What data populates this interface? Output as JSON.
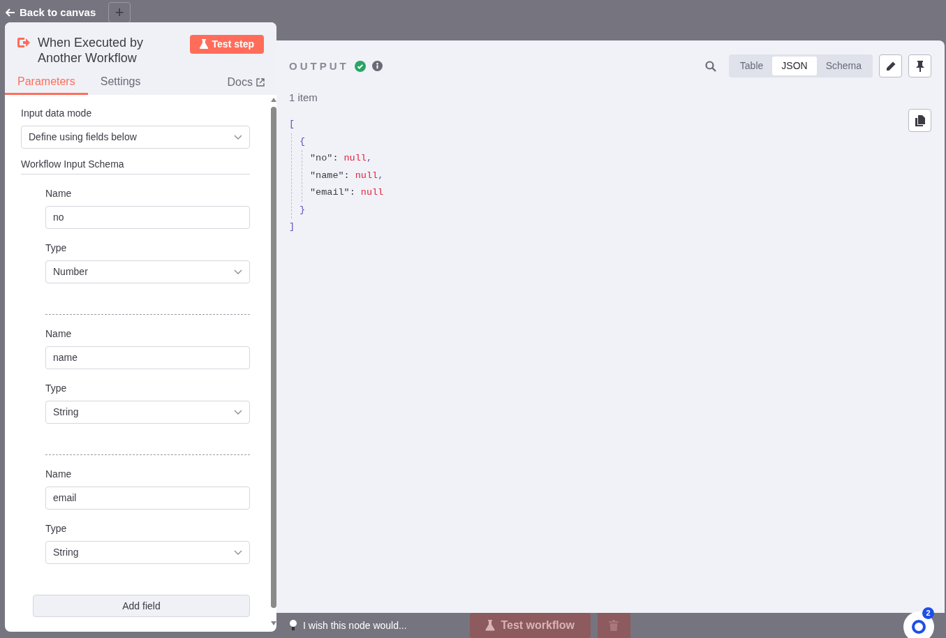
{
  "back_link": "Back to canvas",
  "add_button": "+",
  "node_panel": {
    "title": "When Executed by Another Workflow",
    "test_button": "Test step",
    "tabs": [
      {
        "label": "Parameters",
        "selected": true
      },
      {
        "label": "Settings",
        "selected": false
      }
    ],
    "docs_link": "Docs",
    "input_data_mode": {
      "label": "Input data mode",
      "value": "Define using fields below"
    },
    "schema_heading": "Workflow Input Schema",
    "fields": [
      {
        "name_label": "Name",
        "name": "no",
        "type_label": "Type",
        "type": "Number"
      },
      {
        "name_label": "Name",
        "name": "name",
        "type_label": "Type",
        "type": "String"
      },
      {
        "name_label": "Name",
        "name": "email",
        "type_label": "Type",
        "type": "String"
      }
    ],
    "add_field": "Add field"
  },
  "output_panel": {
    "title": "OUTPUT",
    "success": true,
    "item_count": "1 item",
    "view_modes": [
      {
        "label": "Table",
        "selected": false
      },
      {
        "label": "JSON",
        "selected": true
      },
      {
        "label": "Schema",
        "selected": false
      }
    ],
    "json_view": {
      "open_array": "[",
      "open_object": "{",
      "entries": [
        {
          "key": "\"no\":",
          "value": "null",
          "comma": ","
        },
        {
          "key": "\"name\":",
          "value": "null",
          "comma": ","
        },
        {
          "key": "\"email\":",
          "value": "null"
        }
      ],
      "close_object": "}",
      "close_array": "]"
    }
  },
  "bottom_bar": {
    "feedback": "I wish this node would...",
    "test_workflow": "Test workflow",
    "notification_count": "2"
  }
}
